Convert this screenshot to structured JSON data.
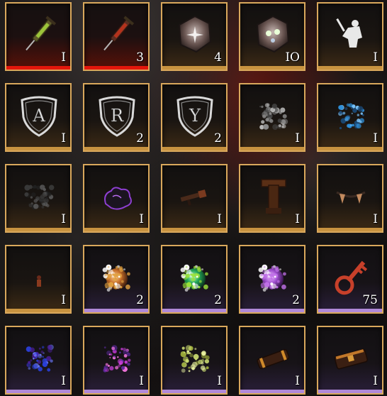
{
  "inventory": {
    "rows": [
      [
        {
          "icon": "syringe-green-icon",
          "rarity": "red",
          "count": "I"
        },
        {
          "icon": "syringe-red-icon",
          "rarity": "red",
          "count": "3"
        },
        {
          "icon": "crystal-geode-icon",
          "rarity": "gold",
          "count": "4"
        },
        {
          "icon": "glowing-geode-icon",
          "rarity": "gold",
          "count": "IO"
        },
        {
          "icon": "white-figure-icon",
          "rarity": "gold",
          "count": "I"
        }
      ],
      [
        {
          "icon": "shield-letter-icon",
          "letter": "A",
          "rarity": "gold",
          "count": "I"
        },
        {
          "icon": "shield-letter-icon",
          "letter": "R",
          "rarity": "gold",
          "count": "2"
        },
        {
          "icon": "shield-letter-icon",
          "letter": "Y",
          "rarity": "gold",
          "count": "2"
        },
        {
          "icon": "grey-dust-icon",
          "rarity": "gold",
          "count": "I"
        },
        {
          "icon": "blue-crystal-dust-icon",
          "rarity": "gold",
          "count": "I"
        }
      ],
      [
        {
          "icon": "dark-ash-icon",
          "rarity": "gold",
          "count": "I"
        },
        {
          "icon": "purple-outline-debris-icon",
          "rarity": "gold",
          "count": "I"
        },
        {
          "icon": "broken-weapon-icon",
          "rarity": "gold",
          "count": "I"
        },
        {
          "icon": "wooden-post-icon",
          "rarity": "gold",
          "count": "I"
        },
        {
          "icon": "fangs-icon",
          "rarity": "gold",
          "count": "I"
        }
      ],
      [
        {
          "icon": "small-figure-icon",
          "rarity": "gold",
          "count": "I"
        },
        {
          "icon": "orange-orb-icon",
          "rarity": "purple",
          "count": "2"
        },
        {
          "icon": "green-orb-icon",
          "rarity": "purple",
          "count": "2"
        },
        {
          "icon": "purple-orb-icon",
          "rarity": "purple",
          "count": "2"
        },
        {
          "icon": "red-key-icon",
          "rarity": "purple",
          "count": "75"
        }
      ],
      [
        {
          "icon": "blue-dust-icon",
          "rarity": "purple",
          "count": "I"
        },
        {
          "icon": "pink-dust-icon",
          "rarity": "purple",
          "count": "I"
        },
        {
          "icon": "yellow-green-dust-icon",
          "rarity": "purple",
          "count": "I"
        },
        {
          "icon": "scroll-case-icon",
          "rarity": "purple",
          "count": "I"
        },
        {
          "icon": "chest-icon",
          "rarity": "purple",
          "count": "I"
        }
      ]
    ]
  },
  "colors": {
    "slot_border": "#d9a85c",
    "rarity_red": "#e3160b",
    "rarity_gold": "#c89340",
    "rarity_purple": "#b089d8"
  }
}
